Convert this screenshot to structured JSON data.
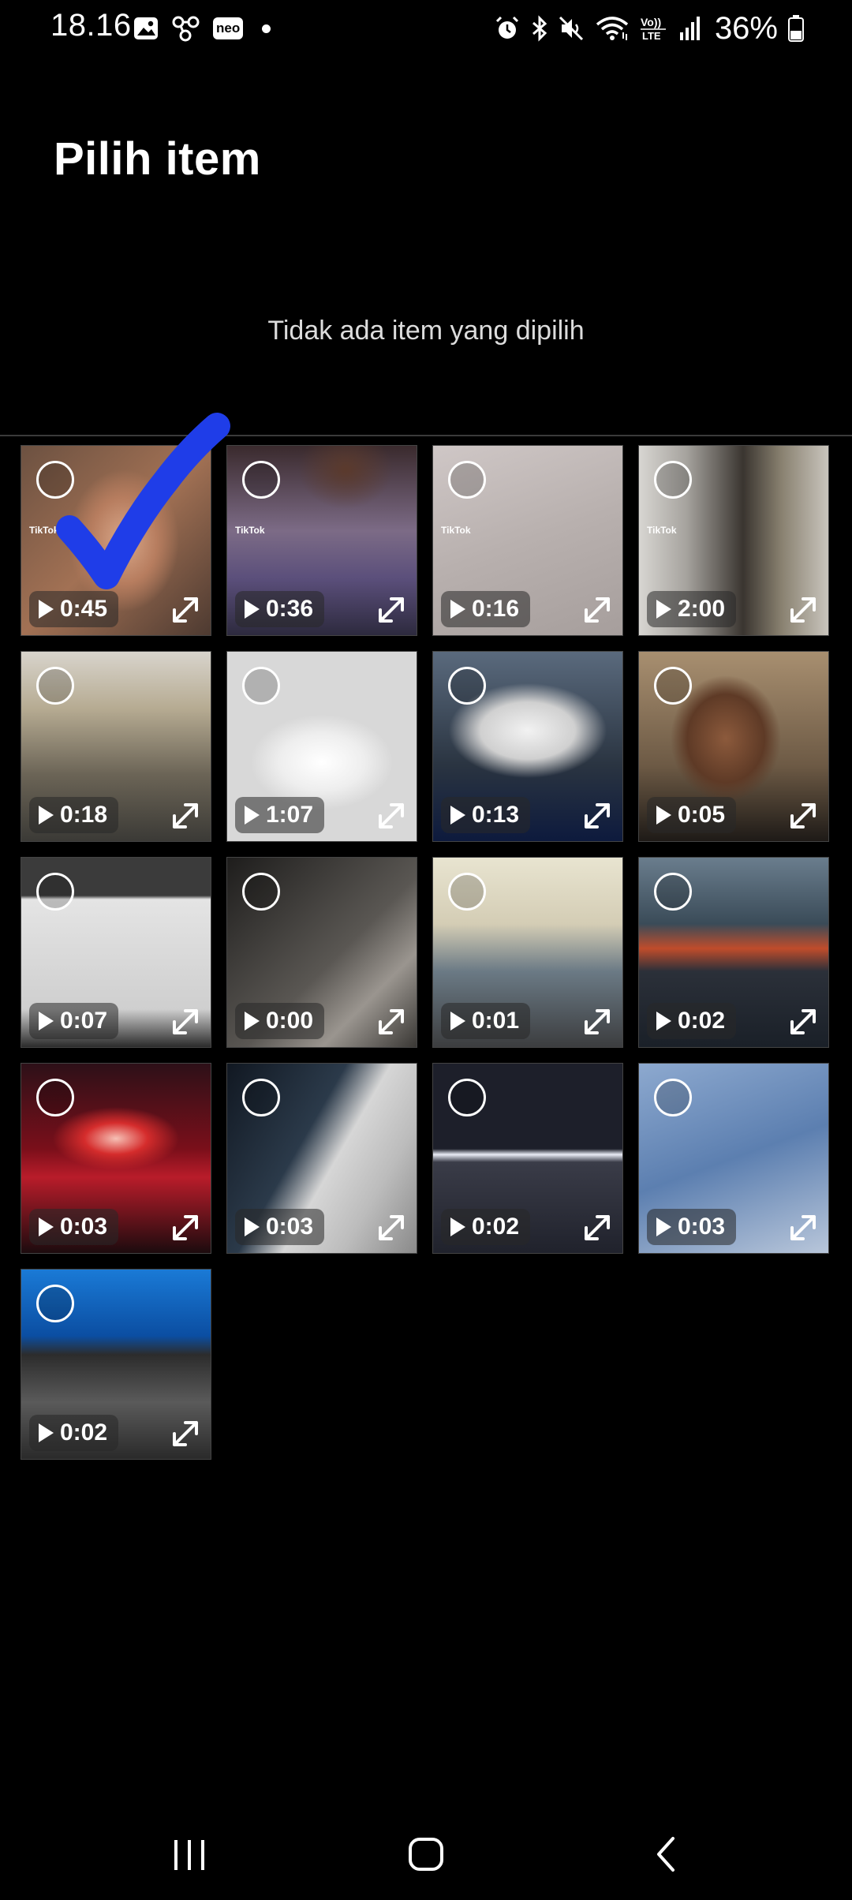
{
  "status_bar": {
    "time": "18.16",
    "neo_label": "neo",
    "volte_label": "Vo)) LTE",
    "battery": "36%"
  },
  "header": {
    "title": "Pilih item",
    "selection_status": "Tidak ada item yang dipilih"
  },
  "grid": {
    "items": [
      {
        "duration": "0:45",
        "thumb": "t-face",
        "watermark": "TikTok",
        "selected": false
      },
      {
        "duration": "0:36",
        "thumb": "t-woman",
        "watermark": "TikTok",
        "selected": false
      },
      {
        "duration": "0:16",
        "thumb": "t-floor",
        "watermark": "TikTok",
        "selected": false
      },
      {
        "duration": "2:00",
        "thumb": "t-office",
        "watermark": "TikTok",
        "selected": false
      },
      {
        "duration": "0:18",
        "thumb": "t-street",
        "watermark": "",
        "selected": false
      },
      {
        "duration": "1:07",
        "thumb": "t-box",
        "watermark": "",
        "selected": false
      },
      {
        "duration": "0:13",
        "thumb": "t-car",
        "watermark": "",
        "selected": false
      },
      {
        "duration": "0:05",
        "thumb": "t-selfie",
        "watermark": "",
        "selected": false
      },
      {
        "duration": "0:07",
        "thumb": "t-charger",
        "watermark": "",
        "selected": false
      },
      {
        "duration": "0:00",
        "thumb": "t-dark",
        "watermark": "",
        "selected": false
      },
      {
        "duration": "0:01",
        "thumb": "t-men",
        "watermark": "",
        "selected": false
      },
      {
        "duration": "0:02",
        "thumb": "t-carlight",
        "watermark": "",
        "selected": false
      },
      {
        "duration": "0:03",
        "thumb": "t-redlight",
        "watermark": "",
        "selected": false
      },
      {
        "duration": "0:03",
        "thumb": "t-silver",
        "watermark": "",
        "selected": false
      },
      {
        "duration": "0:02",
        "thumb": "t-handle",
        "watermark": "",
        "selected": false
      },
      {
        "duration": "0:03",
        "thumb": "t-bmw",
        "watermark": "",
        "selected": false
      },
      {
        "duration": "0:02",
        "thumb": "t-laptop",
        "watermark": "",
        "selected": false
      }
    ]
  },
  "colors": {
    "background": "#000000",
    "text": "#ffffff",
    "secondary_text": "#dcdcdc",
    "annotation_check": "#1f3de8"
  },
  "icons": {
    "status_left": [
      "gallery-icon",
      "share-nodes-icon",
      "neo-badge",
      "notification-dot"
    ],
    "status_right": [
      "alarm-icon",
      "bluetooth-icon",
      "mute-icon",
      "wifi-icon",
      "volte-icon",
      "signal-icon",
      "battery-icon"
    ],
    "navigation": [
      "recent-apps-icon",
      "home-icon",
      "back-icon"
    ],
    "tile": [
      "select-circle",
      "play-icon",
      "expand-icon"
    ]
  }
}
